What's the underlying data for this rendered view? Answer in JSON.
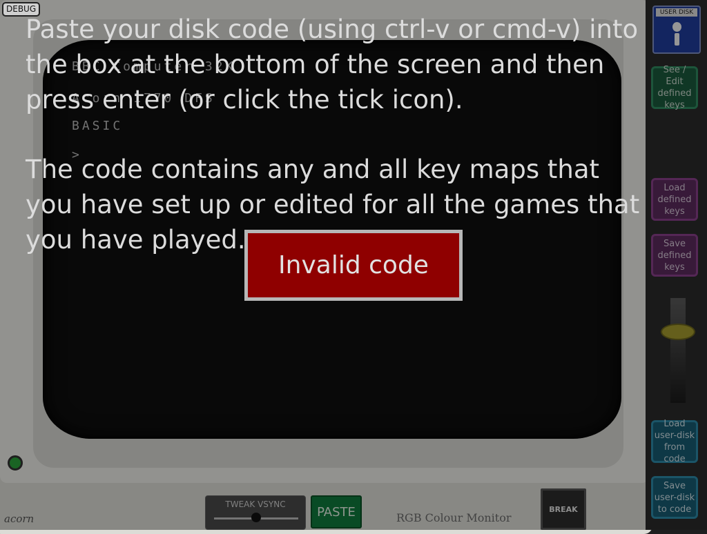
{
  "debug_label": "DEBUG",
  "instructions": {
    "paragraph_1": "Paste your disk code (using ctrl-v or cmd-v) into the box at the bottom of the screen and then press enter (or click the tick icon).",
    "paragraph_2": "The code contains any and all key maps that you have set up or edited for all the games that you have played."
  },
  "error_message": "Invalid code",
  "crt_screen": {
    "line_1": "BBC Computer 32K",
    "line_2": "Acorn 1770 DFS",
    "line_3": "BASIC",
    "prompt": ">"
  },
  "monitor": {
    "brand": "acorn",
    "model_label": "RGB Colour Monitor"
  },
  "controls": {
    "vsync_label": "TWEAK VSYNC",
    "vsync_value": 0.5,
    "paste_label": "PASTE",
    "break_label": "BREAK"
  },
  "sidebar": {
    "user_disk_label": "USER DISK",
    "see_edit_keys": "See / Edit defined keys",
    "load_keys": "Load defined keys",
    "save_keys": "Save defined keys",
    "volume_level": 0.68,
    "load_user_disk": "Load user-disk from code",
    "save_user_disk": "Save user-disk to code"
  },
  "colors": {
    "error_red": "#8f0000",
    "paste_green": "#0f7a3c",
    "purple_button": "#5b2a5c",
    "teal_button": "#175b72"
  }
}
